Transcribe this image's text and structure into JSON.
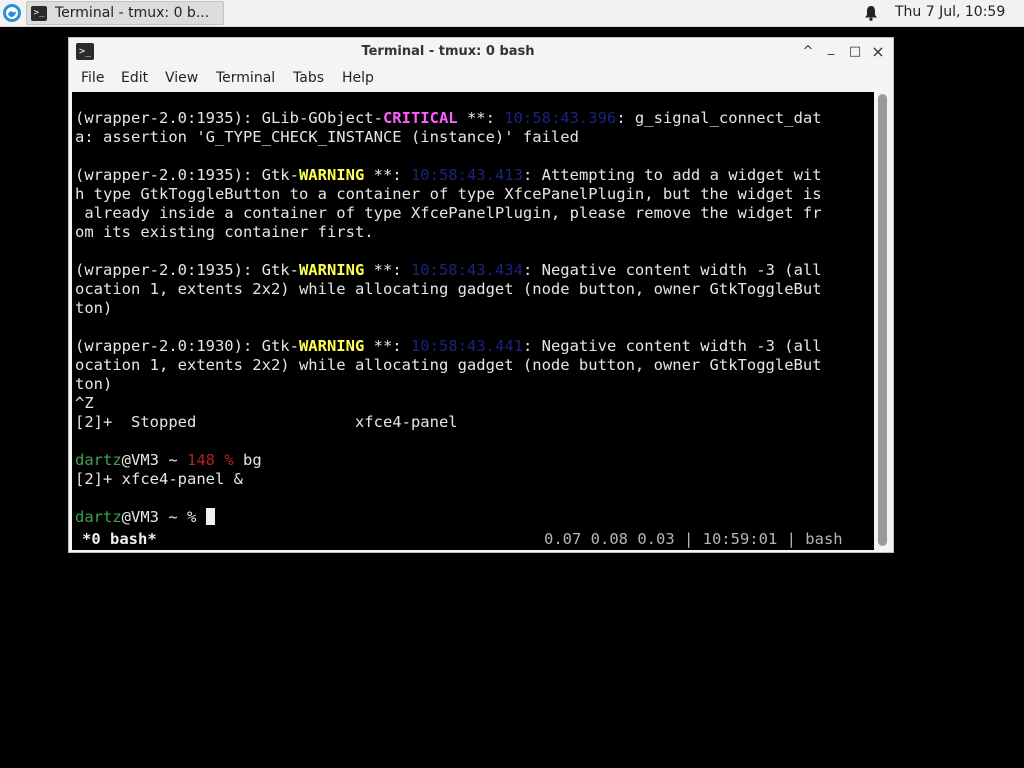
{
  "panel": {
    "task_label": "Terminal - tmux: 0 b...",
    "clock": "Thu  7 Jul, 10:59"
  },
  "window": {
    "title": "Terminal - tmux: 0 bash",
    "controls": [
      "^",
      "_",
      "□",
      "×"
    ]
  },
  "menu": [
    "File",
    "Edit",
    "View",
    "Terminal",
    "Tabs",
    "Help"
  ],
  "terminal": {
    "lines": [
      {
        "p": "(wrapper-2.0:1935): GLib-GObject-",
        "k": "CRITICAL",
        "kc": "crit",
        "s": " **: ",
        "ts": "10:58:43.396",
        "r": ": g_signal_connect_dat"
      },
      {
        "t": "a: assertion 'G_TYPE_CHECK_INSTANCE (instance)' failed"
      },
      {
        "t": ""
      },
      {
        "p": "(wrapper-2.0:1935): Gtk-",
        "k": "WARNING",
        "kc": "warn",
        "s": " **: ",
        "ts": "10:58:43.413",
        "r": ": Attempting to add a widget wit"
      },
      {
        "t": "h type GtkToggleButton to a container of type XfcePanelPlugin, but the widget is"
      },
      {
        "t": " already inside a container of type XfcePanelPlugin, please remove the widget fr"
      },
      {
        "t": "om its existing container first."
      },
      {
        "t": ""
      },
      {
        "p": "(wrapper-2.0:1935): Gtk-",
        "k": "WARNING",
        "kc": "warn",
        "s": " **: ",
        "ts": "10:58:43.434",
        "r": ": Negative content width -3 (all"
      },
      {
        "t": "ocation 1, extents 2x2) while allocating gadget (node button, owner GtkToggleBut"
      },
      {
        "t": "ton)"
      },
      {
        "t": ""
      },
      {
        "p": "(wrapper-2.0:1930): Gtk-",
        "k": "WARNING",
        "kc": "warn",
        "s": " **: ",
        "ts": "10:58:43.441",
        "r": ": Negative content width -3 (all"
      },
      {
        "t": "ocation 1, extents 2x2) while allocating gadget (node button, owner GtkToggleBut"
      },
      {
        "t": "ton)"
      },
      {
        "t": "^Z"
      },
      {
        "t": "[2]+  Stopped                 xfce4-panel"
      },
      {
        "t": ""
      },
      {
        "prompt": true,
        "user": "dartz",
        "host": "@VM3 ~ ",
        "code": "148 % ",
        "cmd": "bg"
      },
      {
        "t": "[2]+ xfce4-panel &"
      },
      {
        "t": ""
      },
      {
        "prompt": true,
        "user": "dartz",
        "host": "@VM3 ~ % ",
        "code": "",
        "cmd": "",
        "cursor": true
      }
    ]
  },
  "tmux": {
    "left": "*0 bash*",
    "right": "0.07 0.08 0.03 | 10:59:01 | bash"
  }
}
